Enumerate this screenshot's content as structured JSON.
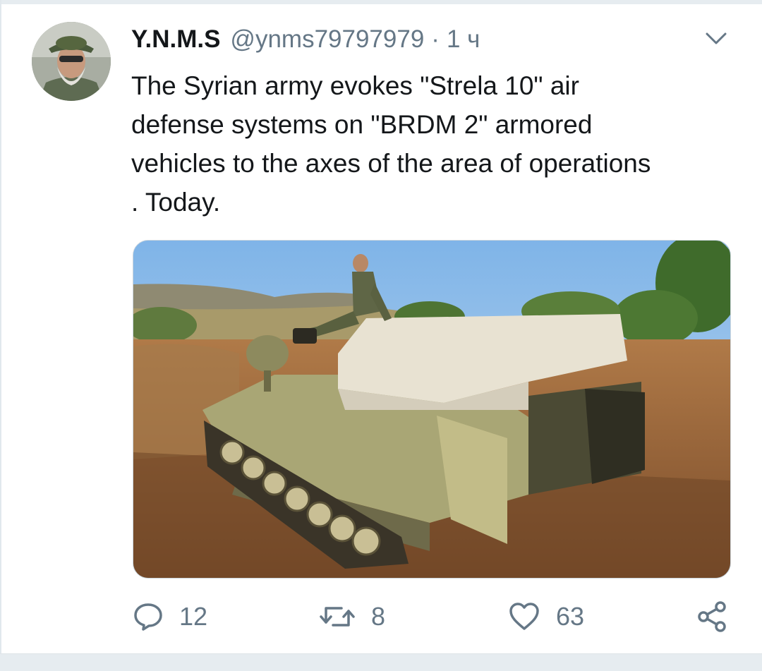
{
  "tweet": {
    "display_name": "Y.N.M.S",
    "handle": "@ynms79797979",
    "separator": "·",
    "time": "1 ч",
    "text": "The Syrian army evokes \"Strela 10\" air\ndefense systems on \"BRDM 2\" armored\nvehicles to the axes of the area of operations\n. Today."
  },
  "actions": {
    "replies": "12",
    "retweets": "8",
    "likes": "63"
  },
  "icons": {
    "reply": "speech-bubble-icon",
    "retweet": "retweet-arrows-icon",
    "like": "heart-icon",
    "share": "share-icon",
    "menu": "chevron-down-icon"
  },
  "colors": {
    "text_primary": "#14171a",
    "text_secondary": "#657786"
  }
}
